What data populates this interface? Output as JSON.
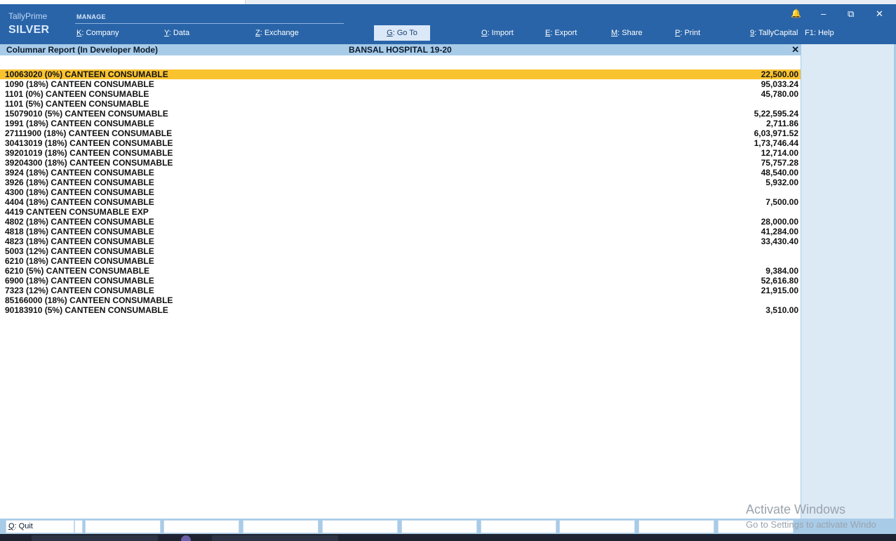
{
  "app": {
    "brand_prime": "TallyPrime",
    "brand_edition": "SILVER",
    "section_label": "MANAGE"
  },
  "menu": [
    {
      "key": "K",
      "label": ": Company"
    },
    {
      "key": "Y",
      "label": ": Data"
    },
    {
      "key": "Z",
      "label": ": Exchange"
    },
    {
      "key": "G",
      "label": ": Go To"
    },
    {
      "key": "O",
      "label": ": Import"
    },
    {
      "key": "E",
      "label": ": Export"
    },
    {
      "key": "M",
      "label": ": Share"
    },
    {
      "key": "P",
      "label": ": Print"
    },
    {
      "key": "9",
      "label": ": TallyCapital"
    },
    {
      "key": "",
      "label": "F1: Help"
    }
  ],
  "window_controls": {
    "bell": "🔔",
    "minimize": "–",
    "restore": "⧉",
    "close": "✕"
  },
  "report": {
    "title": "Columnar Report (In Developer Mode)",
    "company": "BANSAL HOSPITAL 19-20",
    "close_glyph": "✕",
    "rows": [
      {
        "name": "10063020 (0%) CANTEEN CONSUMABLE",
        "amount": "22,500.00",
        "selected": true
      },
      {
        "name": "1090 (18%) CANTEEN CONSUMABLE",
        "amount": "95,033.24"
      },
      {
        "name": "1101 (0%) CANTEEN CONSUMABLE",
        "amount": "45,780.00"
      },
      {
        "name": "1101 (5%) CANTEEN CONSUMABLE",
        "amount": ""
      },
      {
        "name": "15079010 (5%) CANTEEN CONSUMABLE",
        "amount": "5,22,595.24"
      },
      {
        "name": "1991 (18%) CANTEEN CONSUMABLE",
        "amount": "2,711.86"
      },
      {
        "name": "27111900 (18%) CANTEEN CONSUMABLE",
        "amount": "6,03,971.52"
      },
      {
        "name": "30413019 (18%) CANTEEN CONSUMABLE",
        "amount": "1,73,746.44"
      },
      {
        "name": "39201019 (18%) CANTEEN CONSUMABLE",
        "amount": "12,714.00"
      },
      {
        "name": "39204300 (18%) CANTEEN CONSUMABLE",
        "amount": "75,757.28"
      },
      {
        "name": "3924 (18%) CANTEEN CONSUMABLE",
        "amount": "48,540.00"
      },
      {
        "name": "3926 (18%) CANTEEN CONSUMABLE",
        "amount": "5,932.00"
      },
      {
        "name": "4300 (18%) CANTEEN CONSUMABLE",
        "amount": ""
      },
      {
        "name": "4404 (18%) CANTEEN CONSUMABLE",
        "amount": "7,500.00"
      },
      {
        "name": "4419 CANTEEN CONSUMABLE EXP",
        "amount": ""
      },
      {
        "name": "4802 (18%) CANTEEN CONSUMABLE",
        "amount": "28,000.00"
      },
      {
        "name": "4818 (18%) CANTEEN CONSUMABLE",
        "amount": "41,284.00"
      },
      {
        "name": "4823 (18%) CANTEEN CONSUMABLE",
        "amount": "33,430.40"
      },
      {
        "name": "5003 (12%) CANTEEN CONSUMABLE",
        "amount": ""
      },
      {
        "name": "6210 (18%) CANTEEN CONSUMABLE",
        "amount": ""
      },
      {
        "name": "6210 (5%) CANTEEN CONSUMABLE",
        "amount": "9,384.00"
      },
      {
        "name": "6900 (18%) CANTEEN CONSUMABLE",
        "amount": "52,616.80"
      },
      {
        "name": "7323 (12%) CANTEEN CONSUMABLE",
        "amount": "21,915.00"
      },
      {
        "name": "85166000 (18%) CANTEEN CONSUMABLE",
        "amount": ""
      },
      {
        "name": "90183910 (5%) CANTEEN CONSUMABLE",
        "amount": "3,510.00"
      }
    ]
  },
  "footer": {
    "quit_key": "Q",
    "quit_label": ": Quit"
  },
  "watermark": {
    "line1": "Activate Windows",
    "line2": "Go to Settings to activate Windo"
  },
  "colors": {
    "header": "#2964a8",
    "titlebar": "#a8cbe8",
    "selected_row": "#f9c330"
  }
}
